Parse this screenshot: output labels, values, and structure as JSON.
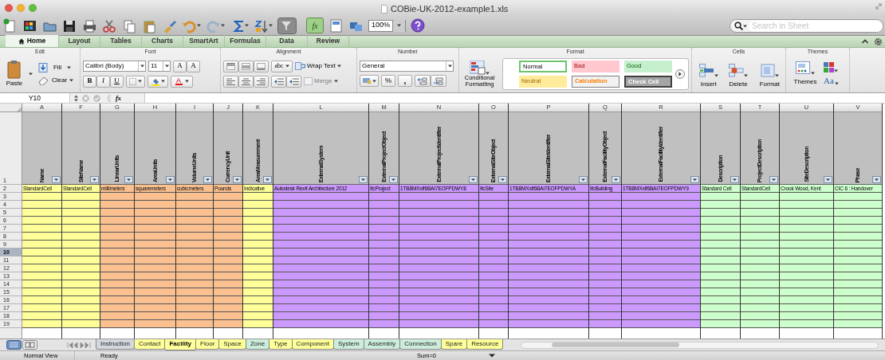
{
  "window": {
    "title": "COBie-UK-2012-example1.xls"
  },
  "toolbar": {
    "formula_builder": "fx",
    "zoom": "100%",
    "search": {
      "placeholder": "Search in Sheet"
    }
  },
  "ribbon_tabs": [
    {
      "label": "Home",
      "selected": true
    },
    {
      "label": "Layout",
      "selected": false
    },
    {
      "label": "Tables",
      "selected": false
    },
    {
      "label": "Charts",
      "selected": false
    },
    {
      "label": "SmartArt",
      "selected": false
    },
    {
      "label": "Formulas",
      "selected": false
    },
    {
      "label": "Data",
      "selected": false
    },
    {
      "label": "Review",
      "selected": false
    }
  ],
  "ribbon": {
    "edit": {
      "title": "Edit",
      "paste": "Paste",
      "fill": "Fill",
      "clear": "Clear"
    },
    "font": {
      "title": "Font",
      "font_name": "Calibri (Body)",
      "font_size": "11",
      "grow": "A",
      "shrink": "A",
      "bold": "B",
      "italic": "I",
      "underline": "U",
      "font_color": "A"
    },
    "alignment": {
      "title": "Alignment",
      "orientation": "abc",
      "wrap_text": "Wrap Text",
      "merge": {
        "label": "Merge",
        "disabled": true
      }
    },
    "number": {
      "title": "Number",
      "format": "General",
      "percent": "%",
      "comma": ","
    },
    "format": {
      "title": "Format",
      "conditional_formatting": "Conditional Formatting",
      "styles": [
        {
          "label": "Normal",
          "kind": "normal"
        },
        {
          "label": "Bad",
          "kind": "bad"
        },
        {
          "label": "Good",
          "kind": "good"
        },
        {
          "label": "Neutral",
          "kind": "neutral"
        },
        {
          "label": "Calculation",
          "kind": "calculation"
        },
        {
          "label": "Check Cell",
          "kind": "check"
        }
      ]
    },
    "cells": {
      "title": "Cells",
      "buttons": [
        "Insert",
        "Delete",
        "Format"
      ]
    },
    "themes": {
      "title": "Themes",
      "themes": "Themes",
      "fonts": "Aa"
    }
  },
  "formula_bar": {
    "name_box": "Y10",
    "fx": "fx"
  },
  "columns": [
    {
      "letter": "A",
      "header": "Name",
      "value": "StandardCell",
      "color": "#ffff99"
    },
    {
      "letter": "F",
      "header": "SiteName",
      "value": "StandardCell",
      "color": "#ffff99"
    },
    {
      "letter": "G",
      "header": "LinearUnits",
      "value": "millimeters",
      "color": "#fac090"
    },
    {
      "letter": "H",
      "header": "AreaUnits",
      "value": "squaremeters",
      "color": "#fac090"
    },
    {
      "letter": "I",
      "header": "VolumeUnits",
      "value": "cubicmeters",
      "color": "#fac090"
    },
    {
      "letter": "J",
      "header": "CurrencyUnit",
      "value": "Pounds",
      "color": "#fac090"
    },
    {
      "letter": "K",
      "header": "AreaMeasurement",
      "value": "Indicative",
      "color": "#ffff99"
    },
    {
      "letter": "L",
      "header": "ExternalSystem",
      "value": "Autodesk Revit Architecture 2012",
      "color": "#cc99ff"
    },
    {
      "letter": "M",
      "header": "ExternalProjectObject",
      "value": "IfcProject",
      "color": "#cc99ff"
    },
    {
      "letter": "N",
      "header": "ExternalProjectIdentifier",
      "value": "1TB8MXxlf6BAI7EOFPDWY8",
      "color": "#cc99ff"
    },
    {
      "letter": "O",
      "header": "ExternalSiteObject",
      "value": "IfcSite",
      "color": "#cc99ff"
    },
    {
      "letter": "P",
      "header": "ExternalSiteIdentifier",
      "value": "1TB8MXxlf6BAI7EOFPDWYA",
      "color": "#cc99ff"
    },
    {
      "letter": "Q",
      "header": "ExternalFacilityObject",
      "value": "IfcBuilding",
      "color": "#cc99ff"
    },
    {
      "letter": "R",
      "header": "ExternalFacilityIdentifier",
      "value": "1TB8MXxlf6BAI7EOFPDWY9",
      "color": "#cc99ff"
    },
    {
      "letter": "S",
      "header": "Description",
      "value": "Standard Cell",
      "color": "#ccffcc"
    },
    {
      "letter": "T",
      "header": "ProjectDescription",
      "value": "StandardCell",
      "color": "#ccffcc"
    },
    {
      "letter": "U",
      "header": "SiteDescription",
      "value": "Crook Wood, Kent",
      "color": "#ccffcc"
    },
    {
      "letter": "V",
      "header": "Phase",
      "value": "CIC 6 : Handover",
      "color": "#ccffcc"
    }
  ],
  "rows": [
    {
      "label": "1",
      "selected": false
    },
    {
      "label": "2",
      "selected": false
    },
    {
      "label": "3",
      "selected": false
    },
    {
      "label": "4",
      "selected": false
    },
    {
      "label": "5",
      "selected": false
    },
    {
      "label": "6",
      "selected": false
    },
    {
      "label": "7",
      "selected": false
    },
    {
      "label": "8",
      "selected": false
    },
    {
      "label": "9",
      "selected": false
    },
    {
      "label": "10",
      "selected": true
    },
    {
      "label": "11",
      "selected": false
    },
    {
      "label": "12",
      "selected": false
    },
    {
      "label": "13",
      "selected": false
    },
    {
      "label": "14",
      "selected": false
    },
    {
      "label": "15",
      "selected": false
    },
    {
      "label": "16",
      "selected": false
    },
    {
      "label": "17",
      "selected": false
    },
    {
      "label": "18",
      "selected": false
    },
    {
      "label": "19",
      "selected": false
    }
  ],
  "sheet_tabs": [
    {
      "label": "Instruction",
      "selected": false,
      "color": "#d3d8de"
    },
    {
      "label": "Contact",
      "selected": false,
      "color": "#ffff99"
    },
    {
      "label": "Facility",
      "selected": true,
      "color": "#ffff99"
    },
    {
      "label": "Floor",
      "selected": false,
      "color": "#ffff99"
    },
    {
      "label": "Space",
      "selected": false,
      "color": "#ffff99"
    },
    {
      "label": "Zone",
      "selected": false,
      "color": "#ccecdc"
    },
    {
      "label": "Type",
      "selected": false,
      "color": "#ffff99"
    },
    {
      "label": "Component",
      "selected": false,
      "color": "#ffff99"
    },
    {
      "label": "System",
      "selected": false,
      "color": "#ccecdc"
    },
    {
      "label": "Assembly",
      "selected": false,
      "color": "#ccecdc"
    },
    {
      "label": "Connection",
      "selected": false,
      "color": "#ccecdc"
    },
    {
      "label": "Spare",
      "selected": false,
      "color": "#ffff99"
    },
    {
      "label": "Resource",
      "selected": false,
      "color": "#ffff99"
    }
  ],
  "status_bar": {
    "view": "Normal View",
    "state": "Ready",
    "sum": "Sum=0"
  }
}
